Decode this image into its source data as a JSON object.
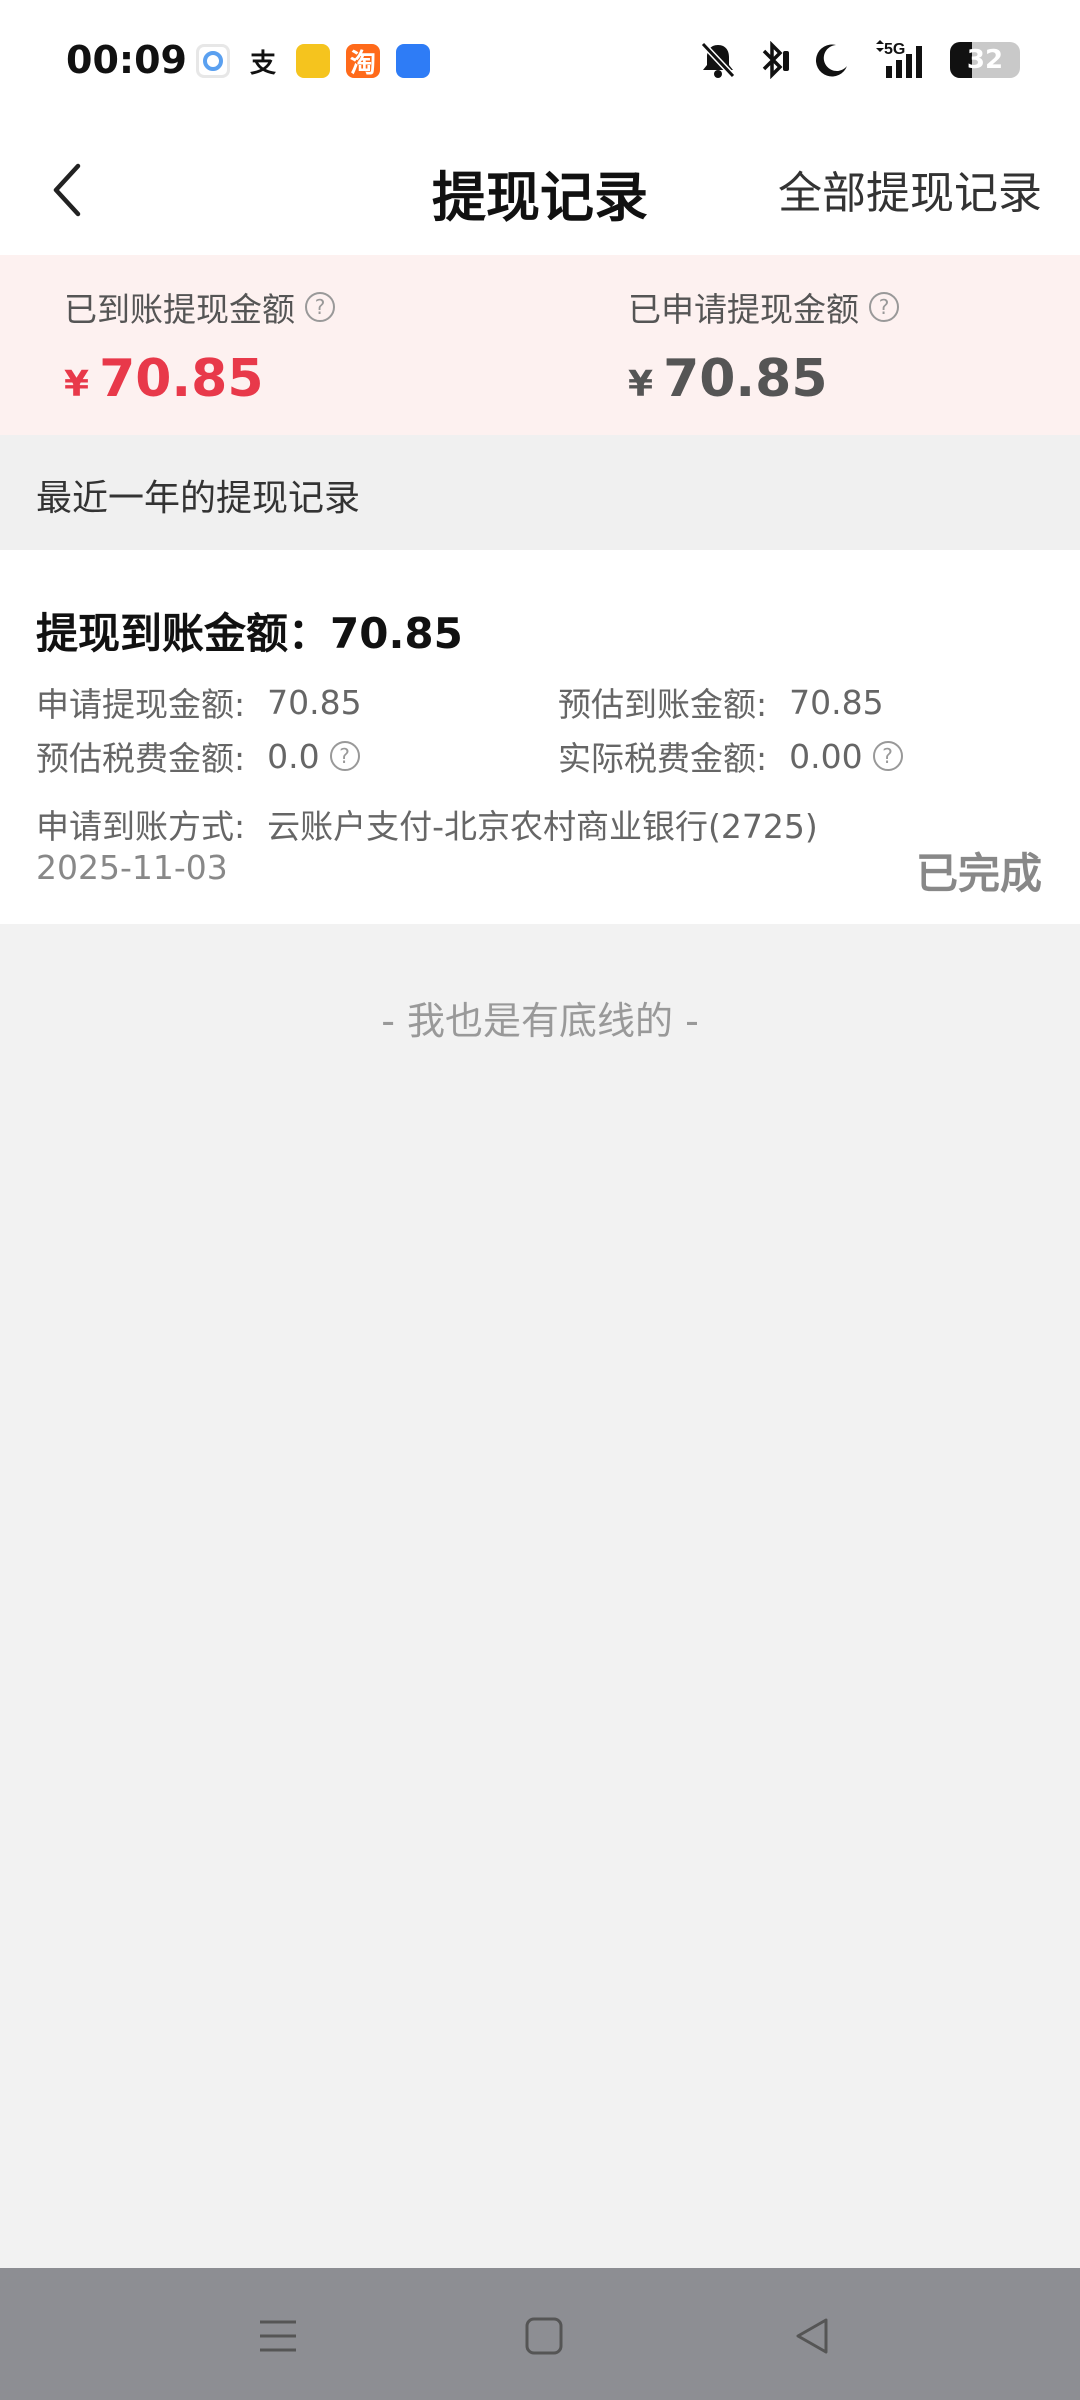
{
  "status_bar": {
    "time": "00:09",
    "notification_icons": [
      "bubble-app-icon",
      "alipay-icon",
      "video-app-icon",
      "taobao-icon",
      "browser-icon"
    ],
    "taobao_glyph": "淘",
    "alipay_glyph": "支",
    "system_icons": [
      "mute-bell-icon",
      "bluetooth-icon",
      "moon-icon",
      "signal-5g-icon",
      "battery-icon"
    ],
    "network": "5G",
    "battery_level": "32"
  },
  "header": {
    "back_icon": "chevron-left-icon",
    "title": "提现记录",
    "right_link": "全部提现记录"
  },
  "summary": {
    "received_label": "已到账提现金额",
    "received_currency": "¥",
    "received_amount": "70.85",
    "applied_label": "已申请提现金额",
    "applied_currency": "¥",
    "applied_amount": "70.85",
    "help_glyph": "?"
  },
  "section_label": "最近一年的提现记录",
  "record": {
    "title": "提现到账金额：70.85",
    "apply_amount_label": "申请提现金额:",
    "apply_amount_value": "70.85",
    "est_amount_label": "预估到账金额:",
    "est_amount_value": "70.85",
    "est_tax_label": "预估税费金额:",
    "est_tax_value": "0.0",
    "actual_tax_label": "实际税费金额:",
    "actual_tax_value": "0.00",
    "method_label": "申请到账方式:",
    "method_value": "云账户支付-北京农村商业银行(2725)",
    "date": "2025-11-03",
    "status": "已完成"
  },
  "footer_note": "- 我也是有底线的 -",
  "nav_bar": {
    "items": [
      "menu-icon",
      "home-square-icon",
      "back-triangle-icon"
    ]
  },
  "colors": {
    "accent_red": "#e8394a",
    "summary_bg": "#fdf1f0",
    "page_bg": "#f2f2f2",
    "nav_bg": "#8d8e93"
  }
}
